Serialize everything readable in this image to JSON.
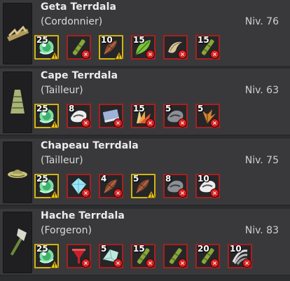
{
  "colors": {
    "missing": "#a82020",
    "owned": "#d2b413",
    "card": "#39393b",
    "background": "#2c2d2f"
  },
  "recipes": [
    {
      "name": "Geta Terrdala",
      "profession": "(Cordonnier)",
      "level": "Niv. 76",
      "icon": "sandal-icon",
      "ingredients": [
        {
          "qty": "25",
          "icon": "green-orb-icon",
          "status": "owned-warning"
        },
        {
          "qty": "",
          "icon": "bamboo-stick-icon",
          "status": "missing"
        },
        {
          "qty": "10",
          "icon": "brown-leaf-icon",
          "status": "owned-warning"
        },
        {
          "qty": "15",
          "icon": "green-leaf-icon",
          "status": "missing"
        },
        {
          "qty": "",
          "icon": "horn-icon",
          "status": "missing"
        },
        {
          "qty": "15",
          "icon": "bamboo-stick-icon",
          "status": "missing"
        }
      ]
    },
    {
      "name": "Cape Terrdala",
      "profession": "(Tailleur)",
      "level": "Niv. 63",
      "icon": "cape-icon",
      "ingredients": [
        {
          "qty": "25",
          "icon": "green-orb-icon",
          "status": "owned-warning"
        },
        {
          "qty": "8",
          "icon": "white-fur-icon",
          "status": "missing"
        },
        {
          "qty": "",
          "icon": "blue-book-icon",
          "status": "missing"
        },
        {
          "qty": "15",
          "icon": "feather-fan-icon",
          "status": "missing"
        },
        {
          "qty": "5",
          "icon": "gray-fur-icon",
          "status": "missing"
        },
        {
          "qty": "5",
          "icon": "orange-leaf-icon",
          "status": "missing"
        }
      ]
    },
    {
      "name": "Chapeau Terrdala",
      "profession": "(Tailleur)",
      "level": "Niv. 75",
      "icon": "hat-icon",
      "ingredients": [
        {
          "qty": "25",
          "icon": "green-orb-icon",
          "status": "owned-warning"
        },
        {
          "qty": "",
          "icon": "blue-crystal-icon",
          "status": "missing"
        },
        {
          "qty": "4",
          "icon": "brown-leaf-icon",
          "status": "missing"
        },
        {
          "qty": "5",
          "icon": "brown-leaf-icon",
          "status": "owned-warning"
        },
        {
          "qty": "8",
          "icon": "gray-fur-icon",
          "status": "missing"
        },
        {
          "qty": "10",
          "icon": "white-fur-icon",
          "status": "missing"
        }
      ]
    },
    {
      "name": "Hache Terrdala",
      "profession": "(Forgeron)",
      "level": "Niv. 83",
      "icon": "axe-icon",
      "ingredients": [
        {
          "qty": "25",
          "icon": "green-orb-icon",
          "status": "owned-warning"
        },
        {
          "qty": "",
          "icon": "red-funnel-icon",
          "status": "missing"
        },
        {
          "qty": "5",
          "icon": "crystal-shard-icon",
          "status": "missing"
        },
        {
          "qty": "15",
          "icon": "bamboo-stick-icon",
          "status": "missing"
        },
        {
          "qty": "",
          "icon": "bamboo-stick-icon",
          "status": "missing"
        },
        {
          "qty": "20",
          "icon": "bamboo-stick-icon",
          "status": "missing"
        },
        {
          "qty": "10",
          "icon": "claw-icon",
          "status": "missing"
        }
      ]
    }
  ]
}
